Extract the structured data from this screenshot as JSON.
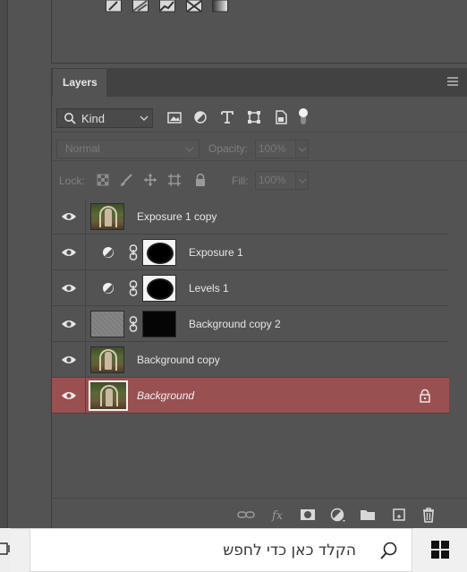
{
  "adjustments_panel": {
    "icons": [
      "brush-adjust-icon",
      "gradient-adjust-icon",
      "posterize-icon",
      "threshold-icon",
      "gradient-map-icon"
    ]
  },
  "layers_panel": {
    "tab_label": "Layers",
    "filter": {
      "kind_label": "Kind",
      "icons": [
        "image-filter-icon",
        "adjustment-filter-icon",
        "type-filter-icon",
        "shape-filter-icon",
        "smart-object-filter-icon",
        "filter-toggle-icon"
      ]
    },
    "blend_mode": "Normal",
    "opacity_label": "Opacity:",
    "opacity_value": "100%",
    "lock_label": "Lock:",
    "fill_label": "Fill:",
    "fill_value": "100%",
    "layers": [
      {
        "name": "Exposure 1 copy",
        "visible": true,
        "kind": "pixel"
      },
      {
        "name": "Exposure 1",
        "visible": true,
        "kind": "adjustment"
      },
      {
        "name": "Levels 1",
        "visible": true,
        "kind": "adjustment"
      },
      {
        "name": "Background copy 2",
        "visible": true,
        "kind": "masked"
      },
      {
        "name": "Background copy",
        "visible": true,
        "kind": "pixel"
      },
      {
        "name": "Background",
        "visible": true,
        "kind": "pixel",
        "selected": true,
        "locked": true
      }
    ],
    "bottom_icons": [
      "link-layers-icon",
      "fx-icon",
      "add-mask-icon",
      "new-adjustment-icon",
      "new-group-icon",
      "new-layer-icon",
      "delete-layer-icon"
    ]
  },
  "taskbar": {
    "search_placeholder": "הקלד כאן כדי לחפש"
  },
  "colors": {
    "panel_bg": "#535353",
    "selected_row": "#995050",
    "taskbar_bg": "#f0f0f0"
  }
}
